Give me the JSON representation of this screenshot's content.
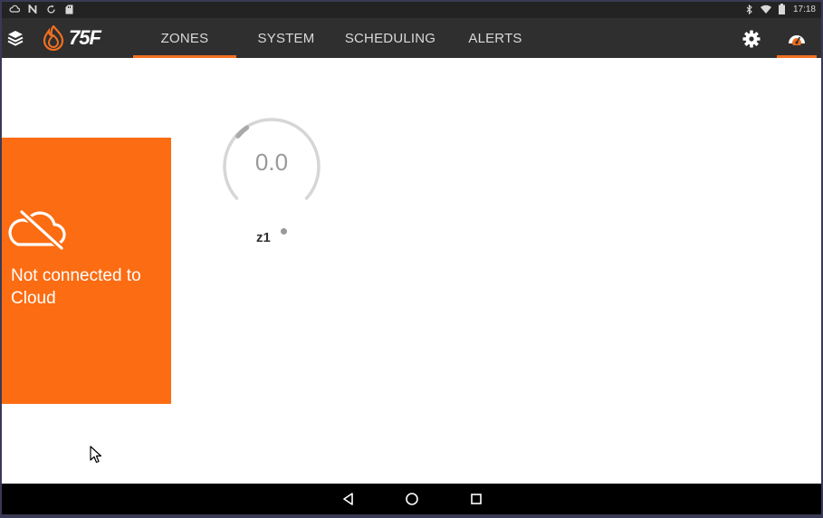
{
  "status_bar": {
    "left_icons": [
      "cloud-outline-icon",
      "n-notification-icon",
      "sync-icon",
      "sd-card-icon"
    ],
    "right_icons": [
      "bluetooth-icon",
      "wifi-icon",
      "battery-icon"
    ],
    "time": "17:18"
  },
  "app_bar": {
    "logo_text": "75F",
    "tabs": [
      {
        "label": "ZONES",
        "active": true
      },
      {
        "label": "SYSTEM",
        "active": false
      },
      {
        "label": "SCHEDULING",
        "active": false
      },
      {
        "label": "ALERTS",
        "active": false
      }
    ],
    "right_icons": [
      "gear-icon",
      "dashboard-icon"
    ]
  },
  "cloud_status": {
    "icon": "cloud-off-icon",
    "message": "Not connected to Cloud"
  },
  "zones": [
    {
      "name": "z1",
      "value": "0.0"
    }
  ],
  "colors": {
    "accent": "#f26f21",
    "card": "#fc6c12",
    "app_bar": "#2f2f2f",
    "status_bar": "#232323"
  },
  "nav_bar": {
    "buttons": [
      "back-icon",
      "home-icon",
      "recents-icon"
    ]
  }
}
